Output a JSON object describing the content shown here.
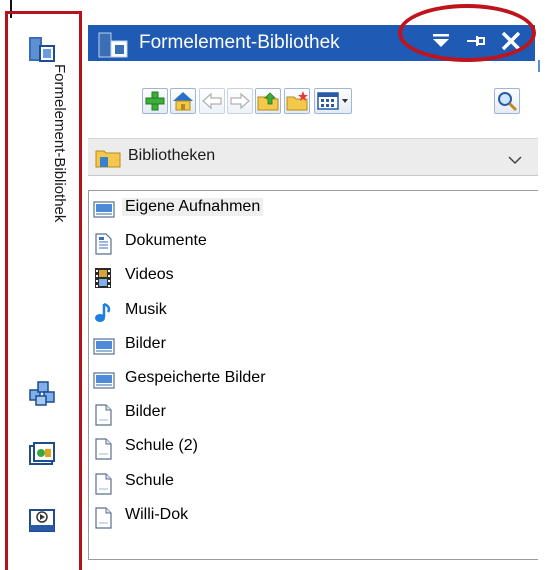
{
  "side_panel": {
    "tab_label": "Formelement-Bibliothek"
  },
  "title_bar": {
    "title": "Formelement-Bibliothek",
    "menu_glyph": "▾",
    "pin_glyph": "⊣",
    "close_glyph": "✕"
  },
  "toolbar": {
    "buttons": [
      "add",
      "home",
      "back",
      "forward",
      "up-folder",
      "new-folder",
      "view-options",
      "search"
    ]
  },
  "location": {
    "selected": "Bibliotheken"
  },
  "list": {
    "items": [
      {
        "label": "Eigene Aufnahmen",
        "icon": "image-file-icon"
      },
      {
        "label": "Dokumente",
        "icon": "document-icon"
      },
      {
        "label": "Videos",
        "icon": "film-icon"
      },
      {
        "label": "Musik",
        "icon": "music-note-icon"
      },
      {
        "label": "Bilder",
        "icon": "image-file-icon"
      },
      {
        "label": "Gespeicherte Bilder",
        "icon": "image-file-icon"
      },
      {
        "label": "Bilder",
        "icon": "blank-file-icon"
      },
      {
        "label": "Schule (2)",
        "icon": "blank-file-icon"
      },
      {
        "label": "Schule",
        "icon": "blank-file-icon"
      },
      {
        "label": "Willi-Dok",
        "icon": "blank-file-icon"
      }
    ]
  },
  "colors": {
    "title_bar": "#1f5ab4",
    "highlight_frame": "#b5121b"
  }
}
